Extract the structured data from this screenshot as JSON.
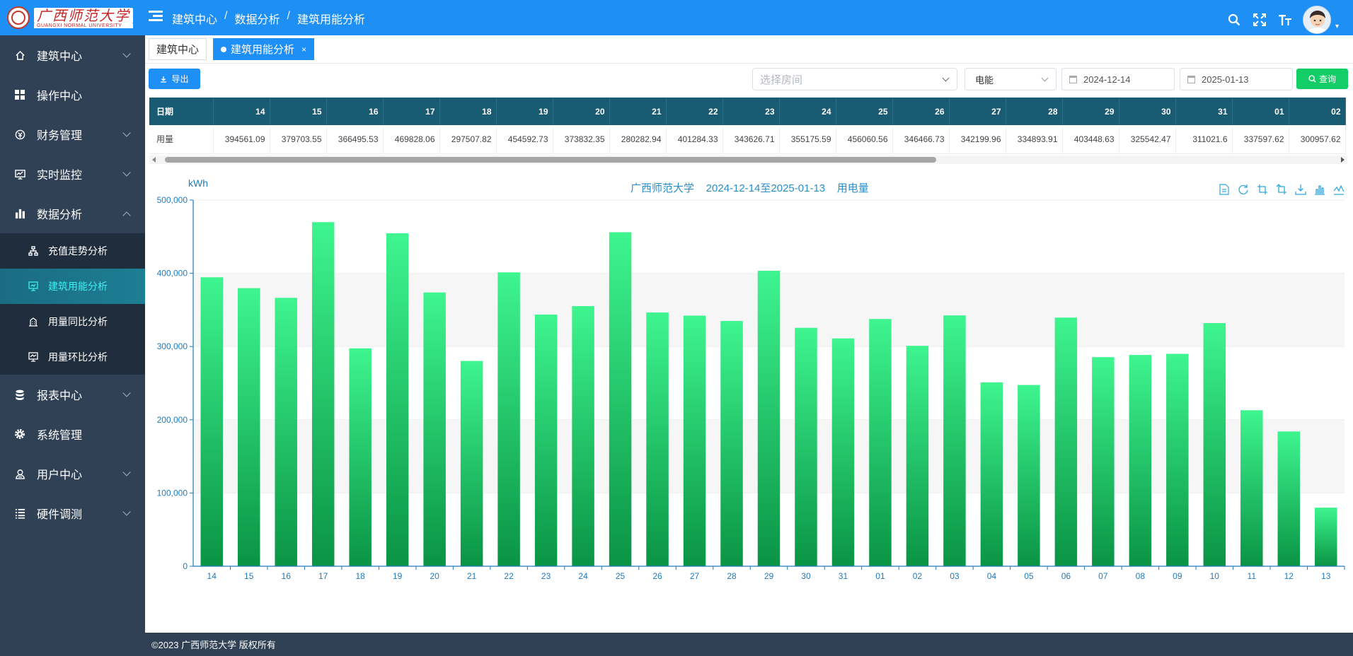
{
  "header": {
    "logo_cn": "广西师范大学",
    "logo_en": "GUANGXI NORMAL UNIVERSITY",
    "breadcrumb": [
      "建筑中心",
      "数据分析",
      "建筑用能分析"
    ],
    "separator": "/"
  },
  "sidebar": {
    "items": [
      {
        "label": "建筑中心",
        "icon": "home-icon"
      },
      {
        "label": "操作中心",
        "icon": "grid-icon"
      },
      {
        "label": "财务管理",
        "icon": "finance-icon"
      },
      {
        "label": "实时监控",
        "icon": "monitor-icon"
      },
      {
        "label": "数据分析",
        "icon": "bar-chart-icon"
      },
      {
        "label": "报表中心",
        "icon": "database-icon"
      },
      {
        "label": "系统管理",
        "icon": "gear-icon"
      },
      {
        "label": "用户中心",
        "icon": "user-icon"
      },
      {
        "label": "硬件调测",
        "icon": "list-icon"
      }
    ],
    "submenu": [
      {
        "label": "充值走势分析",
        "icon": "sitemap-icon"
      },
      {
        "label": "建筑用能分析",
        "icon": "screen-icon"
      },
      {
        "label": "用量同比分析",
        "icon": "building-icon"
      },
      {
        "label": "用量环比分析",
        "icon": "chart-screen-icon"
      }
    ]
  },
  "tags": {
    "home": "建筑中心",
    "active": "建筑用能分析",
    "close": "×"
  },
  "toolbar": {
    "export_label": "导出",
    "room_placeholder": "选择房间",
    "energy_value": "电能",
    "start_date": "2024-12-14",
    "end_date": "2025-01-13",
    "query_label": "查询"
  },
  "table": {
    "row_header": "日期",
    "row_label": "用量",
    "dates": [
      "14",
      "15",
      "16",
      "17",
      "18",
      "19",
      "20",
      "21",
      "22",
      "23",
      "24",
      "25",
      "26",
      "27",
      "28",
      "29",
      "30",
      "31",
      "01",
      "02"
    ],
    "values": [
      "394561.09",
      "379703.55",
      "366495.53",
      "469828.06",
      "297507.82",
      "454592.73",
      "373832.35",
      "280282.94",
      "401284.33",
      "343626.71",
      "355175.59",
      "456060.56",
      "346466.73",
      "342199.96",
      "334893.91",
      "403448.63",
      "325542.47",
      "311021.6",
      "337597.62",
      "300957.62"
    ]
  },
  "colors": {
    "accent": "#1e8ff5",
    "sidebar": "#304156",
    "bar_top": "#3ef58f",
    "bar_bottom": "#0a9444",
    "axis": "#1f7bbd"
  },
  "chart_data": {
    "type": "bar",
    "title": "广西师范大学    2024-12-14至2025-01-13    用电量",
    "ylabel": "kWh",
    "xlabel": "",
    "ylim": [
      0,
      500000
    ],
    "yticks": [
      "0",
      "100,000",
      "200,000",
      "300,000",
      "400,000",
      "500,000"
    ],
    "categories": [
      "14",
      "15",
      "16",
      "17",
      "18",
      "19",
      "20",
      "21",
      "22",
      "23",
      "24",
      "25",
      "26",
      "27",
      "28",
      "29",
      "30",
      "31",
      "01",
      "02",
      "03",
      "04",
      "05",
      "06",
      "07",
      "08",
      "09",
      "10",
      "11",
      "12",
      "13"
    ],
    "values": [
      394561.09,
      379703.55,
      366495.53,
      469828.06,
      297507.82,
      454592.73,
      373832.35,
      280282.94,
      401284.33,
      343626.71,
      355175.59,
      456060.56,
      346466.73,
      342199.96,
      334893.91,
      403448.63,
      325542.47,
      311021.6,
      337597.62,
      300957.62,
      342500,
      251000,
      247500,
      339500,
      285500,
      288500,
      290000,
      332000,
      213000,
      184000,
      80000
    ],
    "grid": true
  },
  "footer": {
    "copyright": "©2023 广西师范大学 版权所有"
  }
}
